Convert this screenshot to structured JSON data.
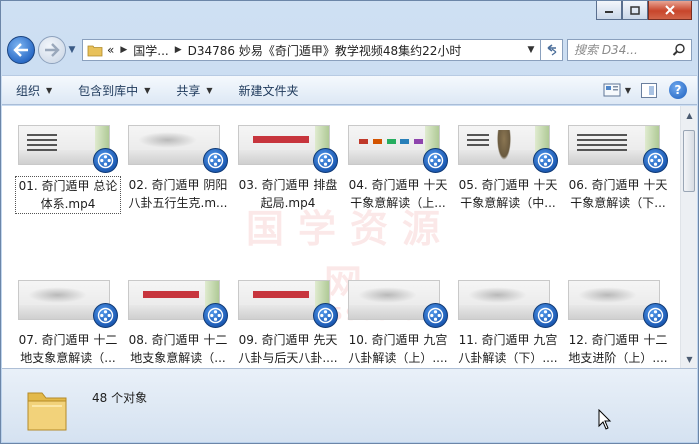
{
  "window": {
    "minimize_icon": "minimize-icon",
    "maximize_icon": "maximize-icon",
    "close_icon": "close-icon"
  },
  "address": {
    "overflow": "«",
    "crumbs": [
      "国学...",
      "D34786 妙易《奇门遁甲》教学视频48集约22小时"
    ]
  },
  "search": {
    "placeholder": "搜索 D34..."
  },
  "toolbar": {
    "organize": "组织",
    "include_in_library": "包含到库中",
    "share": "共享",
    "new_folder": "新建文件夹"
  },
  "watermark": {
    "main": "国学资源网",
    "sub": "www.95959.com"
  },
  "files": [
    {
      "name": "01. 奇门遁甲 总论体系.mp4",
      "line1": "01. 奇门遁甲 总论",
      "line2": "体系.mp4",
      "thumb": "lines",
      "selected": true
    },
    {
      "name": "02. 奇门遁甲 阴阳八卦五行生克.m...",
      "line1": "02. 奇门遁甲 阴阳",
      "line2": "八卦五行生克.m...",
      "thumb": "mist"
    },
    {
      "name": "03. 奇门遁甲 排盘起局.mp4",
      "line1": "03. 奇门遁甲 排盘",
      "line2": "起局.mp4",
      "thumb": "title"
    },
    {
      "name": "04. 奇门遁甲 十天干象意解读（上...",
      "line1": "04. 奇门遁甲 十天",
      "line2": "干象意解读（上...",
      "thumb": "boxes"
    },
    {
      "name": "05. 奇门遁甲 十天干象意解读（中...",
      "line1": "05. 奇门遁甲 十天",
      "line2": "干象意解读（中...",
      "thumb": "figure"
    },
    {
      "name": "06. 奇门遁甲 十天干象意解读（下...",
      "line1": "06. 奇门遁甲 十天",
      "line2": "干象意解读（下...",
      "thumb": "list"
    },
    {
      "name": "07. 奇门遁甲 十二地支象意解读（...",
      "line1": "07. 奇门遁甲 十二",
      "line2": "地支象意解读（...",
      "thumb": "mist"
    },
    {
      "name": "08. 奇门遁甲 十二地支象意解读（...",
      "line1": "08. 奇门遁甲 十二",
      "line2": "地支象意解读（...",
      "thumb": "title"
    },
    {
      "name": "09. 奇门遁甲 先天八卦与后天八卦....",
      "line1": "09. 奇门遁甲 先天",
      "line2": "八卦与后天八卦....",
      "thumb": "title"
    },
    {
      "name": "10. 奇门遁甲 九宫八卦解读（上）....",
      "line1": "10. 奇门遁甲 九宫",
      "line2": "八卦解读（上）....",
      "thumb": "mist"
    },
    {
      "name": "11. 奇门遁甲 九宫八卦解读（下）....",
      "line1": "11. 奇门遁甲 九宫",
      "line2": "八卦解读（下）....",
      "thumb": "mist"
    },
    {
      "name": "12. 奇门遁甲 十二地支进阶（上）....",
      "line1": "12. 奇门遁甲 十二",
      "line2": "地支进阶（上）....",
      "thumb": "mist"
    }
  ],
  "status": {
    "count": "48 个对象"
  },
  "colors": {
    "accent": "#2c6cc7",
    "title_red": "#c7353d"
  }
}
